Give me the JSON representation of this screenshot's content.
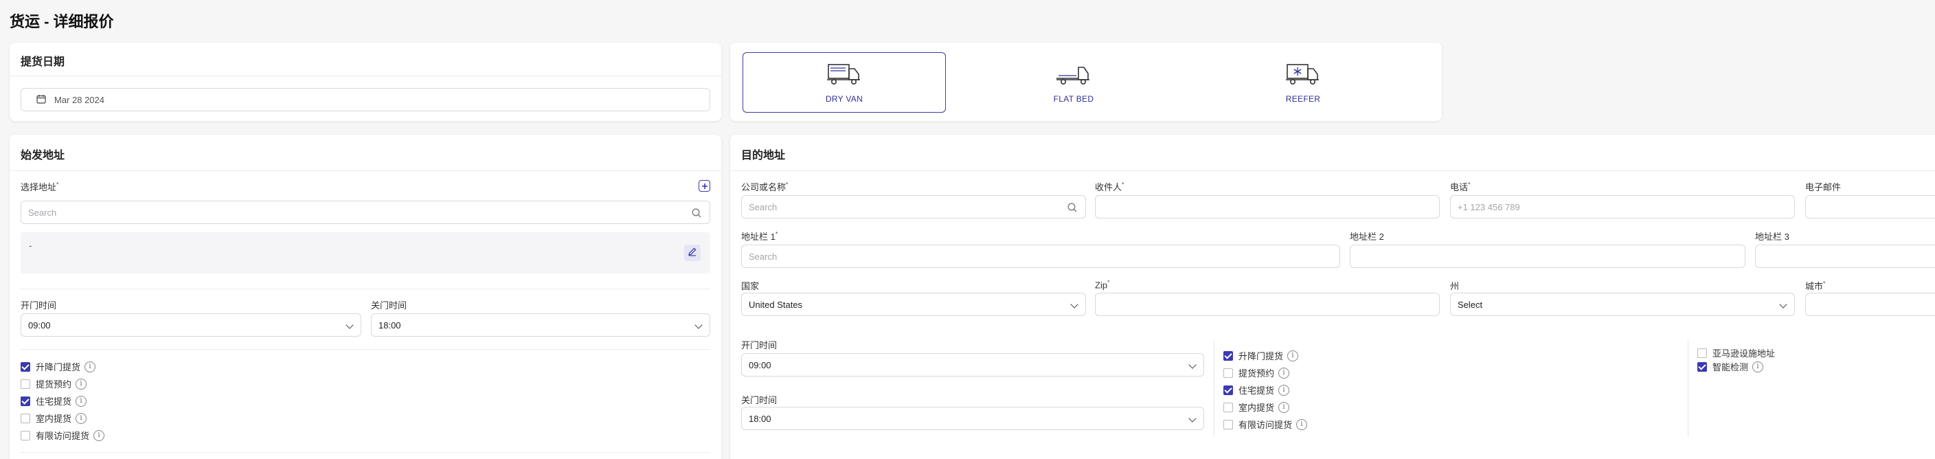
{
  "page": {
    "title": "货运 - 详细报价"
  },
  "pickup_date": {
    "title": "提货日期",
    "value": "Mar 28 2024"
  },
  "truck_types": [
    {
      "label": "DRY VAN",
      "icon": "dry-van-truck-icon",
      "selected": true
    },
    {
      "label": "FLAT BED",
      "icon": "flat-bed-truck-icon",
      "selected": false
    },
    {
      "label": "REEFER",
      "icon": "reefer-truck-icon",
      "selected": false
    }
  ],
  "origin": {
    "title": "始发地址",
    "select_label": "选择地址",
    "search_placeholder": "Search",
    "address_value": "-",
    "open_time_label": "开门时间",
    "open_time_value": "09:00",
    "close_time_label": "关门时间",
    "close_time_value": "18:00",
    "options": [
      {
        "label": "升降门提货",
        "checked": true
      },
      {
        "label": "提货预约",
        "checked": false
      },
      {
        "label": "住宅提货",
        "checked": true
      },
      {
        "label": "室内提货",
        "checked": false
      },
      {
        "label": "有限访问提货",
        "checked": false
      }
    ]
  },
  "destination": {
    "title": "目的地址",
    "company_label": "公司或名称",
    "company_placeholder": "Search",
    "recipient_label": "收件人",
    "phone_label": "电话",
    "phone_placeholder": "+1 123 456 789",
    "email_label": "电子邮件",
    "address1_label": "地址栏 1",
    "address1_placeholder": "Search",
    "address2_label": "地址栏 2",
    "address3_label": "地址栏 3",
    "country_label": "国家",
    "country_value": "United States",
    "zip_label": "Zip",
    "state_label": "州",
    "state_value": "Select",
    "city_label": "城市",
    "open_time_label": "开门时间",
    "open_time_value": "09:00",
    "close_time_label": "关门时间",
    "close_time_value": "18:00",
    "options": [
      {
        "label": "升降门提货",
        "checked": true
      },
      {
        "label": "提货预约",
        "checked": false
      },
      {
        "label": "住宅提货",
        "checked": true
      },
      {
        "label": "室内提货",
        "checked": false
      },
      {
        "label": "有限访问提货",
        "checked": false
      }
    ],
    "extra_options": [
      {
        "label": "亚马逊设施地址",
        "checked": false
      },
      {
        "label": "智能检测",
        "checked": true
      }
    ]
  },
  "colors": {
    "accent": "#3a3ab3",
    "border": "#d9d9de",
    "background": "#f6f6f7"
  }
}
